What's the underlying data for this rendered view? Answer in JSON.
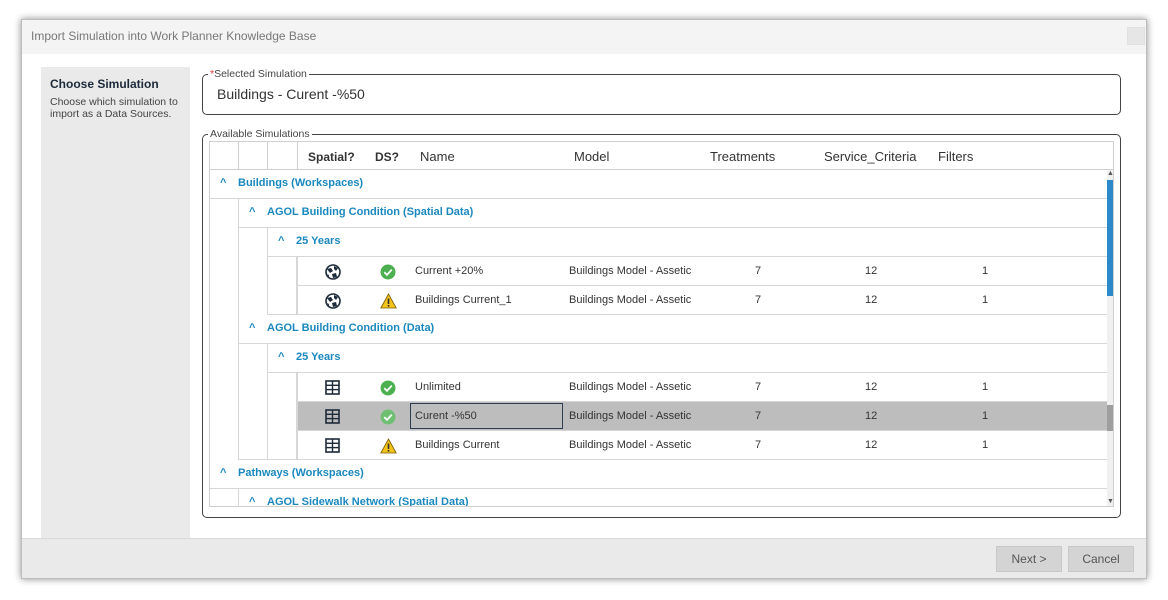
{
  "dialog": {
    "title": "Import Simulation into Work Planner Knowledge Base"
  },
  "left_panel": {
    "title": "Choose Simulation",
    "description": "Choose which simulation to import as a Data Sources."
  },
  "selected_simulation": {
    "required_mark": "*",
    "label": "Selected Simulation",
    "value": "Buildings - Curent -%50"
  },
  "available": {
    "label": "Available Simulations",
    "columns": {
      "spatial": "Spatial?",
      "ds": "DS?",
      "name": "Name",
      "model": "Model",
      "treatments": "Treatments",
      "service_criteria": "Service_Criteria",
      "filters": "Filters"
    },
    "groups": {
      "g1": "Buildings (Workspaces)",
      "g1a": "AGOL Building Condition (Spatial Data)",
      "g1a_y": "25 Years",
      "g1b": "AGOL Building Condition (Data)",
      "g1b_y": "25 Years",
      "g2": "Pathways (Workspaces)",
      "g2a": "AGOL Sidewalk Network (Spatial Data)"
    },
    "rows": [
      {
        "spatial_icon": "globe-icon",
        "ds_icon": "check-icon",
        "name": "Current +20%",
        "model": "Buildings Model - Assetic",
        "treatments": "7",
        "service_criteria": "12",
        "filters": "1"
      },
      {
        "spatial_icon": "globe-icon",
        "ds_icon": "warning-icon",
        "name": "Buildings Current_1",
        "model": "Buildings Model - Assetic",
        "treatments": "7",
        "service_criteria": "12",
        "filters": "1"
      },
      {
        "spatial_icon": "table-icon",
        "ds_icon": "check-icon",
        "name": "Unlimited",
        "model": "Buildings Model - Assetic",
        "treatments": "7",
        "service_criteria": "12",
        "filters": "1"
      },
      {
        "spatial_icon": "table-icon",
        "ds_icon": "check-icon",
        "name": "Curent -%50",
        "model": "Buildings Model - Assetic",
        "treatments": "7",
        "service_criteria": "12",
        "filters": "1"
      },
      {
        "spatial_icon": "table-icon",
        "ds_icon": "warning-icon",
        "name": "Buildings Current",
        "model": "Buildings Model - Assetic",
        "treatments": "7",
        "service_criteria": "12",
        "filters": "1"
      }
    ]
  },
  "footer": {
    "next_label": "Next >",
    "cancel_label": "Cancel"
  },
  "colors": {
    "accent": "#1a88bf",
    "check": "#4caf50",
    "warning": "#f2c318",
    "selected_row": "#bdbdbd"
  }
}
